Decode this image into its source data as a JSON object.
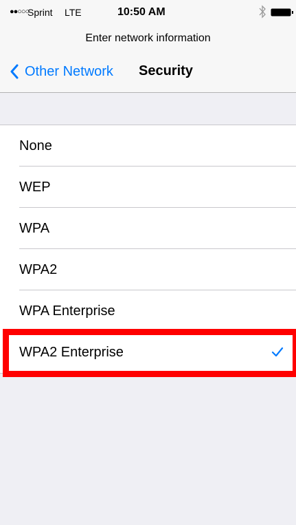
{
  "status": {
    "signal": "●●○○○",
    "carrier": "Sprint",
    "network_type": "LTE",
    "time": "10:50 AM",
    "icons": [
      "bluetooth-icon",
      "battery-icon"
    ]
  },
  "prompt": "Enter network information",
  "nav": {
    "back_label": "Other Network",
    "title": "Security"
  },
  "options": [
    {
      "label": "None",
      "selected": false
    },
    {
      "label": "WEP",
      "selected": false
    },
    {
      "label": "WPA",
      "selected": false
    },
    {
      "label": "WPA2",
      "selected": false
    },
    {
      "label": "WPA Enterprise",
      "selected": false
    },
    {
      "label": "WPA2 Enterprise",
      "selected": true
    }
  ],
  "colors": {
    "accent": "#007aff",
    "background": "#efeff4",
    "highlight": "#ff0000"
  }
}
